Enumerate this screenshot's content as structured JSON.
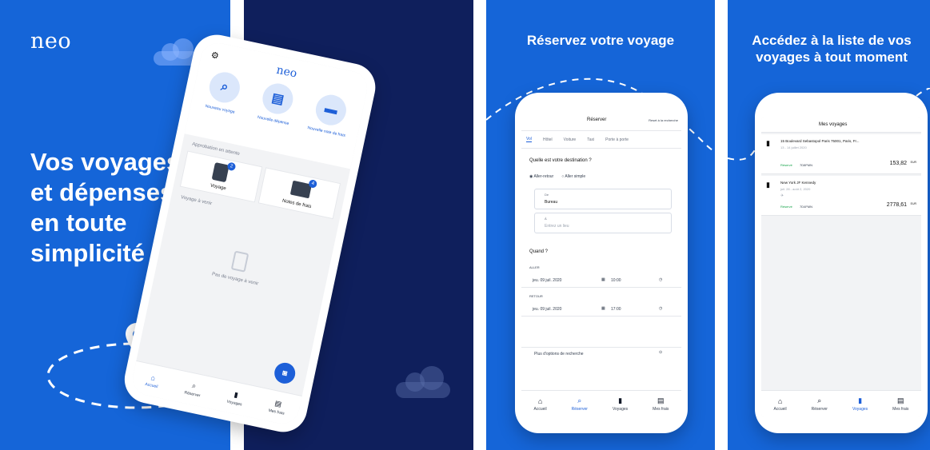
{
  "panel1": {
    "logo": "neo",
    "hero_lines": [
      "Vos voyages",
      "et dépenses",
      "en toute",
      "simplicité"
    ]
  },
  "panel2": {
    "logo": "neo",
    "quick_actions": [
      {
        "label": "Nouveau voyage",
        "icon": "search-icon"
      },
      {
        "label": "Nouvelle dépense",
        "icon": "receipt-icon"
      },
      {
        "label": "Nouvelle note de frais",
        "icon": "folder-icon"
      }
    ],
    "section_pending": "Approbation en attente",
    "pending_cards": [
      {
        "label": "Voyage",
        "badge": "2"
      },
      {
        "label": "Notes de frais",
        "badge": "4"
      }
    ],
    "section_upcoming": "Voyage à venir",
    "empty_text": "Pas de voyage à venir",
    "nav": [
      "Accueil",
      "Réserver",
      "Voyages",
      "Mes frais"
    ],
    "active_nav": 0
  },
  "panel3": {
    "title": "Réservez votre voyage",
    "screen_title": "Réserver",
    "screen_action": "Reset à la recherche",
    "tabs": [
      "Vol",
      "Hôtel",
      "Voiture",
      "Taxi",
      "Porte à porte"
    ],
    "question": "Quelle est votre destination ?",
    "trip_types": [
      "Aller-retour",
      "Aller simple"
    ],
    "from_label": "De",
    "from_value": "Bureau",
    "to_label": "À",
    "to_placeholder": "Entrez un lieu",
    "when": "Quand ?",
    "aller_label": "ALLER",
    "aller_date": "jeu. 09 juil. 2020",
    "aller_time": "10:00",
    "retour_label": "RETOUR",
    "retour_date": "jeu. 09 juil. 2020",
    "retour_time": "17:00",
    "more_options": "Plus d'options de recherche",
    "nav": [
      "Accueil",
      "Réserver",
      "Voyages",
      "Mes frais"
    ],
    "active_nav": 1
  },
  "panel4": {
    "title_line1": "Accédez à la liste de vos",
    "title_line2": "voyages à tout moment",
    "screen_title": "Mes voyages",
    "trips": [
      {
        "name": "15 Boulevard Sebastopol Paris 75001, Paris, Fr...",
        "date": "13 - 14 juillet 2020",
        "status": "Réservé",
        "ref": "7D8FMN",
        "price": "153,82",
        "currency": "EUR"
      },
      {
        "name": "New York JF Kennedy",
        "date": "juil. 28 - août 2, 2020",
        "status": "Réservé",
        "ref": "7D4FMN",
        "price": "2778,61",
        "currency": "EUR"
      }
    ],
    "nav": [
      "Accueil",
      "Réserver",
      "Voyages",
      "Mes frais"
    ],
    "active_nav": 2
  },
  "colors": {
    "brand_blue": "#1565d8",
    "navy": "#0f1f5c",
    "accent": "#1d5fd8",
    "success": "#16a34a"
  }
}
